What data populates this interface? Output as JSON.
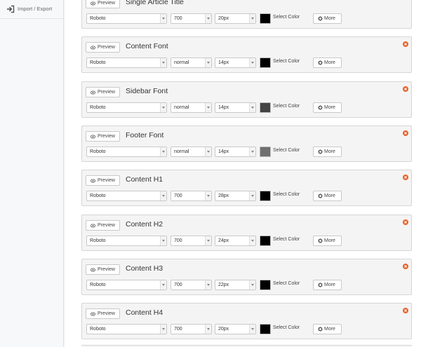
{
  "sidebar": {
    "import_export_label": "Import / Export"
  },
  "common": {
    "preview_label": "Preview",
    "select_color_label": "Select Color",
    "more_label": "More"
  },
  "font_settings": [
    {
      "title": "Single Article Title",
      "font": "Roboto",
      "weight": "700",
      "size": "20px",
      "color": "#000000"
    },
    {
      "title": "Content Font",
      "font": "Roboto",
      "weight": "normal",
      "size": "14px",
      "color": "#000000"
    },
    {
      "title": "Sidebar Font",
      "font": "Roboto",
      "weight": "normal",
      "size": "14px",
      "color": "#444444"
    },
    {
      "title": "Footer Font",
      "font": "Roboto",
      "weight": "normal",
      "size": "14px",
      "color": "#6f6f6f"
    },
    {
      "title": "Content H1",
      "font": "Roboto",
      "weight": "700",
      "size": "28px",
      "color": "#000000"
    },
    {
      "title": "Content H2",
      "font": "Roboto",
      "weight": "700",
      "size": "24px",
      "color": "#000000"
    },
    {
      "title": "Content H3",
      "font": "Roboto",
      "weight": "700",
      "size": "22px",
      "color": "#000000"
    },
    {
      "title": "Content H4",
      "font": "Roboto",
      "weight": "700",
      "size": "20px",
      "color": "#000000"
    }
  ],
  "colors": {
    "close_icon": "#e8632a"
  }
}
